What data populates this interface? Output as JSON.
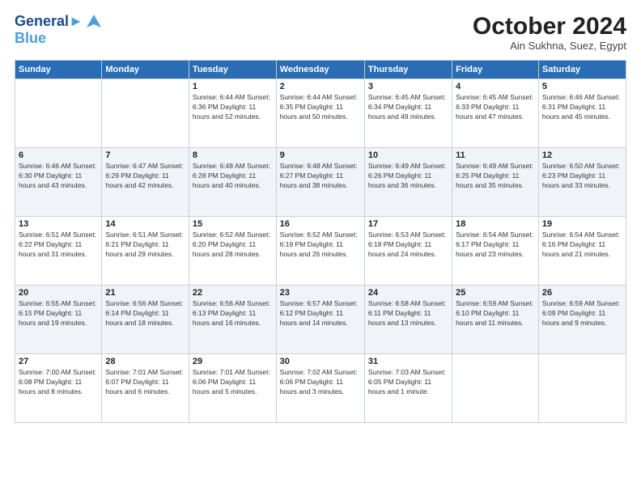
{
  "header": {
    "logo_line1": "General",
    "logo_line2": "Blue",
    "month_title": "October 2024",
    "location": "Ain Sukhna, Suez, Egypt"
  },
  "weekdays": [
    "Sunday",
    "Monday",
    "Tuesday",
    "Wednesday",
    "Thursday",
    "Friday",
    "Saturday"
  ],
  "weeks": [
    [
      {
        "day": "",
        "info": ""
      },
      {
        "day": "",
        "info": ""
      },
      {
        "day": "1",
        "info": "Sunrise: 6:44 AM\nSunset: 6:36 PM\nDaylight: 11 hours and 52 minutes."
      },
      {
        "day": "2",
        "info": "Sunrise: 6:44 AM\nSunset: 6:35 PM\nDaylight: 11 hours and 50 minutes."
      },
      {
        "day": "3",
        "info": "Sunrise: 6:45 AM\nSunset: 6:34 PM\nDaylight: 11 hours and 49 minutes."
      },
      {
        "day": "4",
        "info": "Sunrise: 6:45 AM\nSunset: 6:33 PM\nDaylight: 11 hours and 47 minutes."
      },
      {
        "day": "5",
        "info": "Sunrise: 6:46 AM\nSunset: 6:31 PM\nDaylight: 11 hours and 45 minutes."
      }
    ],
    [
      {
        "day": "6",
        "info": "Sunrise: 6:46 AM\nSunset: 6:30 PM\nDaylight: 11 hours and 43 minutes."
      },
      {
        "day": "7",
        "info": "Sunrise: 6:47 AM\nSunset: 6:29 PM\nDaylight: 11 hours and 42 minutes."
      },
      {
        "day": "8",
        "info": "Sunrise: 6:48 AM\nSunset: 6:28 PM\nDaylight: 11 hours and 40 minutes."
      },
      {
        "day": "9",
        "info": "Sunrise: 6:48 AM\nSunset: 6:27 PM\nDaylight: 11 hours and 38 minutes."
      },
      {
        "day": "10",
        "info": "Sunrise: 6:49 AM\nSunset: 6:26 PM\nDaylight: 11 hours and 36 minutes."
      },
      {
        "day": "11",
        "info": "Sunrise: 6:49 AM\nSunset: 6:25 PM\nDaylight: 11 hours and 35 minutes."
      },
      {
        "day": "12",
        "info": "Sunrise: 6:50 AM\nSunset: 6:23 PM\nDaylight: 11 hours and 33 minutes."
      }
    ],
    [
      {
        "day": "13",
        "info": "Sunrise: 6:51 AM\nSunset: 6:22 PM\nDaylight: 11 hours and 31 minutes."
      },
      {
        "day": "14",
        "info": "Sunrise: 6:51 AM\nSunset: 6:21 PM\nDaylight: 11 hours and 29 minutes."
      },
      {
        "day": "15",
        "info": "Sunrise: 6:52 AM\nSunset: 6:20 PM\nDaylight: 11 hours and 28 minutes."
      },
      {
        "day": "16",
        "info": "Sunrise: 6:52 AM\nSunset: 6:19 PM\nDaylight: 11 hours and 26 minutes."
      },
      {
        "day": "17",
        "info": "Sunrise: 6:53 AM\nSunset: 6:18 PM\nDaylight: 11 hours and 24 minutes."
      },
      {
        "day": "18",
        "info": "Sunrise: 6:54 AM\nSunset: 6:17 PM\nDaylight: 11 hours and 23 minutes."
      },
      {
        "day": "19",
        "info": "Sunrise: 6:54 AM\nSunset: 6:16 PM\nDaylight: 11 hours and 21 minutes."
      }
    ],
    [
      {
        "day": "20",
        "info": "Sunrise: 6:55 AM\nSunset: 6:15 PM\nDaylight: 11 hours and 19 minutes."
      },
      {
        "day": "21",
        "info": "Sunrise: 6:56 AM\nSunset: 6:14 PM\nDaylight: 11 hours and 18 minutes."
      },
      {
        "day": "22",
        "info": "Sunrise: 6:56 AM\nSunset: 6:13 PM\nDaylight: 11 hours and 16 minutes."
      },
      {
        "day": "23",
        "info": "Sunrise: 6:57 AM\nSunset: 6:12 PM\nDaylight: 11 hours and 14 minutes."
      },
      {
        "day": "24",
        "info": "Sunrise: 6:58 AM\nSunset: 6:11 PM\nDaylight: 11 hours and 13 minutes."
      },
      {
        "day": "25",
        "info": "Sunrise: 6:59 AM\nSunset: 6:10 PM\nDaylight: 11 hours and 11 minutes."
      },
      {
        "day": "26",
        "info": "Sunrise: 6:59 AM\nSunset: 6:09 PM\nDaylight: 11 hours and 9 minutes."
      }
    ],
    [
      {
        "day": "27",
        "info": "Sunrise: 7:00 AM\nSunset: 6:08 PM\nDaylight: 11 hours and 8 minutes."
      },
      {
        "day": "28",
        "info": "Sunrise: 7:01 AM\nSunset: 6:07 PM\nDaylight: 11 hours and 6 minutes."
      },
      {
        "day": "29",
        "info": "Sunrise: 7:01 AM\nSunset: 6:06 PM\nDaylight: 11 hours and 5 minutes."
      },
      {
        "day": "30",
        "info": "Sunrise: 7:02 AM\nSunset: 6:06 PM\nDaylight: 11 hours and 3 minutes."
      },
      {
        "day": "31",
        "info": "Sunrise: 7:03 AM\nSunset: 6:05 PM\nDaylight: 11 hours and 1 minute."
      },
      {
        "day": "",
        "info": ""
      },
      {
        "day": "",
        "info": ""
      }
    ]
  ]
}
